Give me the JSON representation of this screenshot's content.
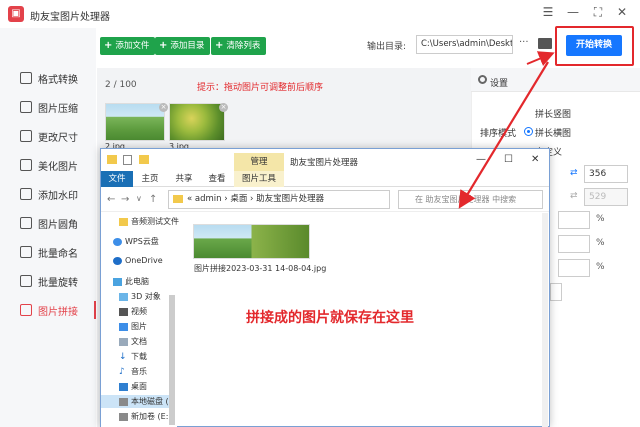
{
  "app": {
    "title": "助友宝图片处理器",
    "logo_glyph": "▣",
    "window_buttons": [
      "☰",
      "—",
      "⛶",
      "✕"
    ]
  },
  "sidebar": {
    "items": [
      {
        "label": "格式转换",
        "active": false
      },
      {
        "label": "图片压缩",
        "active": false
      },
      {
        "label": "更改尺寸",
        "active": false
      },
      {
        "label": "美化图片",
        "active": false
      },
      {
        "label": "添加水印",
        "active": false
      },
      {
        "label": "图片圆角",
        "active": false
      },
      {
        "label": "批量命名",
        "active": false
      },
      {
        "label": "批量旋转",
        "active": false
      },
      {
        "label": "图片拼接",
        "active": true
      }
    ]
  },
  "toolbar": {
    "add_file": "添加文件",
    "add_dir": "添加目录",
    "clear_list": "清除列表",
    "plus": "+",
    "output_label": "输出目录:",
    "output_path": "C:\\Users\\admin\\Deskto",
    "more": "···",
    "start": "开始转换"
  },
  "main": {
    "count": "2 / 100",
    "hint": "提示：拖动图片可调整前后顺序",
    "thumbs": [
      {
        "label": "2.jpg"
      },
      {
        "label": "3.jpg"
      }
    ],
    "close_glyph": "×"
  },
  "settings": {
    "title": "设置",
    "mode_label": "排序模式",
    "options": [
      "拼长竖图",
      "拼长横图",
      "自定义"
    ],
    "width": "356",
    "height": "529",
    "pct_sign": "%",
    "swap": "⇄"
  },
  "explorer": {
    "context_tab": "管理",
    "title": "助友宝图片处理器",
    "win_buttons": [
      "—",
      "☐",
      "✕"
    ],
    "tabs": [
      "文件",
      "主页",
      "共享",
      "查看",
      "图片工具"
    ],
    "address": "«  admin  ›  桌面  ›  助友宝图片处理器",
    "search_placeholder": "在 助友宝图片处理器 中搜索",
    "nav": [
      "←",
      "→",
      "∨",
      "↑"
    ],
    "tree": [
      "音频测试文件",
      "WPS云盘",
      "OneDrive",
      "此电脑",
      "3D 对象",
      "视频",
      "图片",
      "文档",
      "下载",
      "音乐",
      "桌面",
      "本地磁盘 (C:)",
      "新加卷 (E:)"
    ],
    "file": {
      "name": "图片拼接2023-03-31 14-08-04.jpg"
    }
  },
  "annotation": "拼接成的图片就保存在这里",
  "colors": {
    "accent_red": "#e3282c",
    "primary_blue": "#1677ff",
    "green": "#1fa34b"
  }
}
